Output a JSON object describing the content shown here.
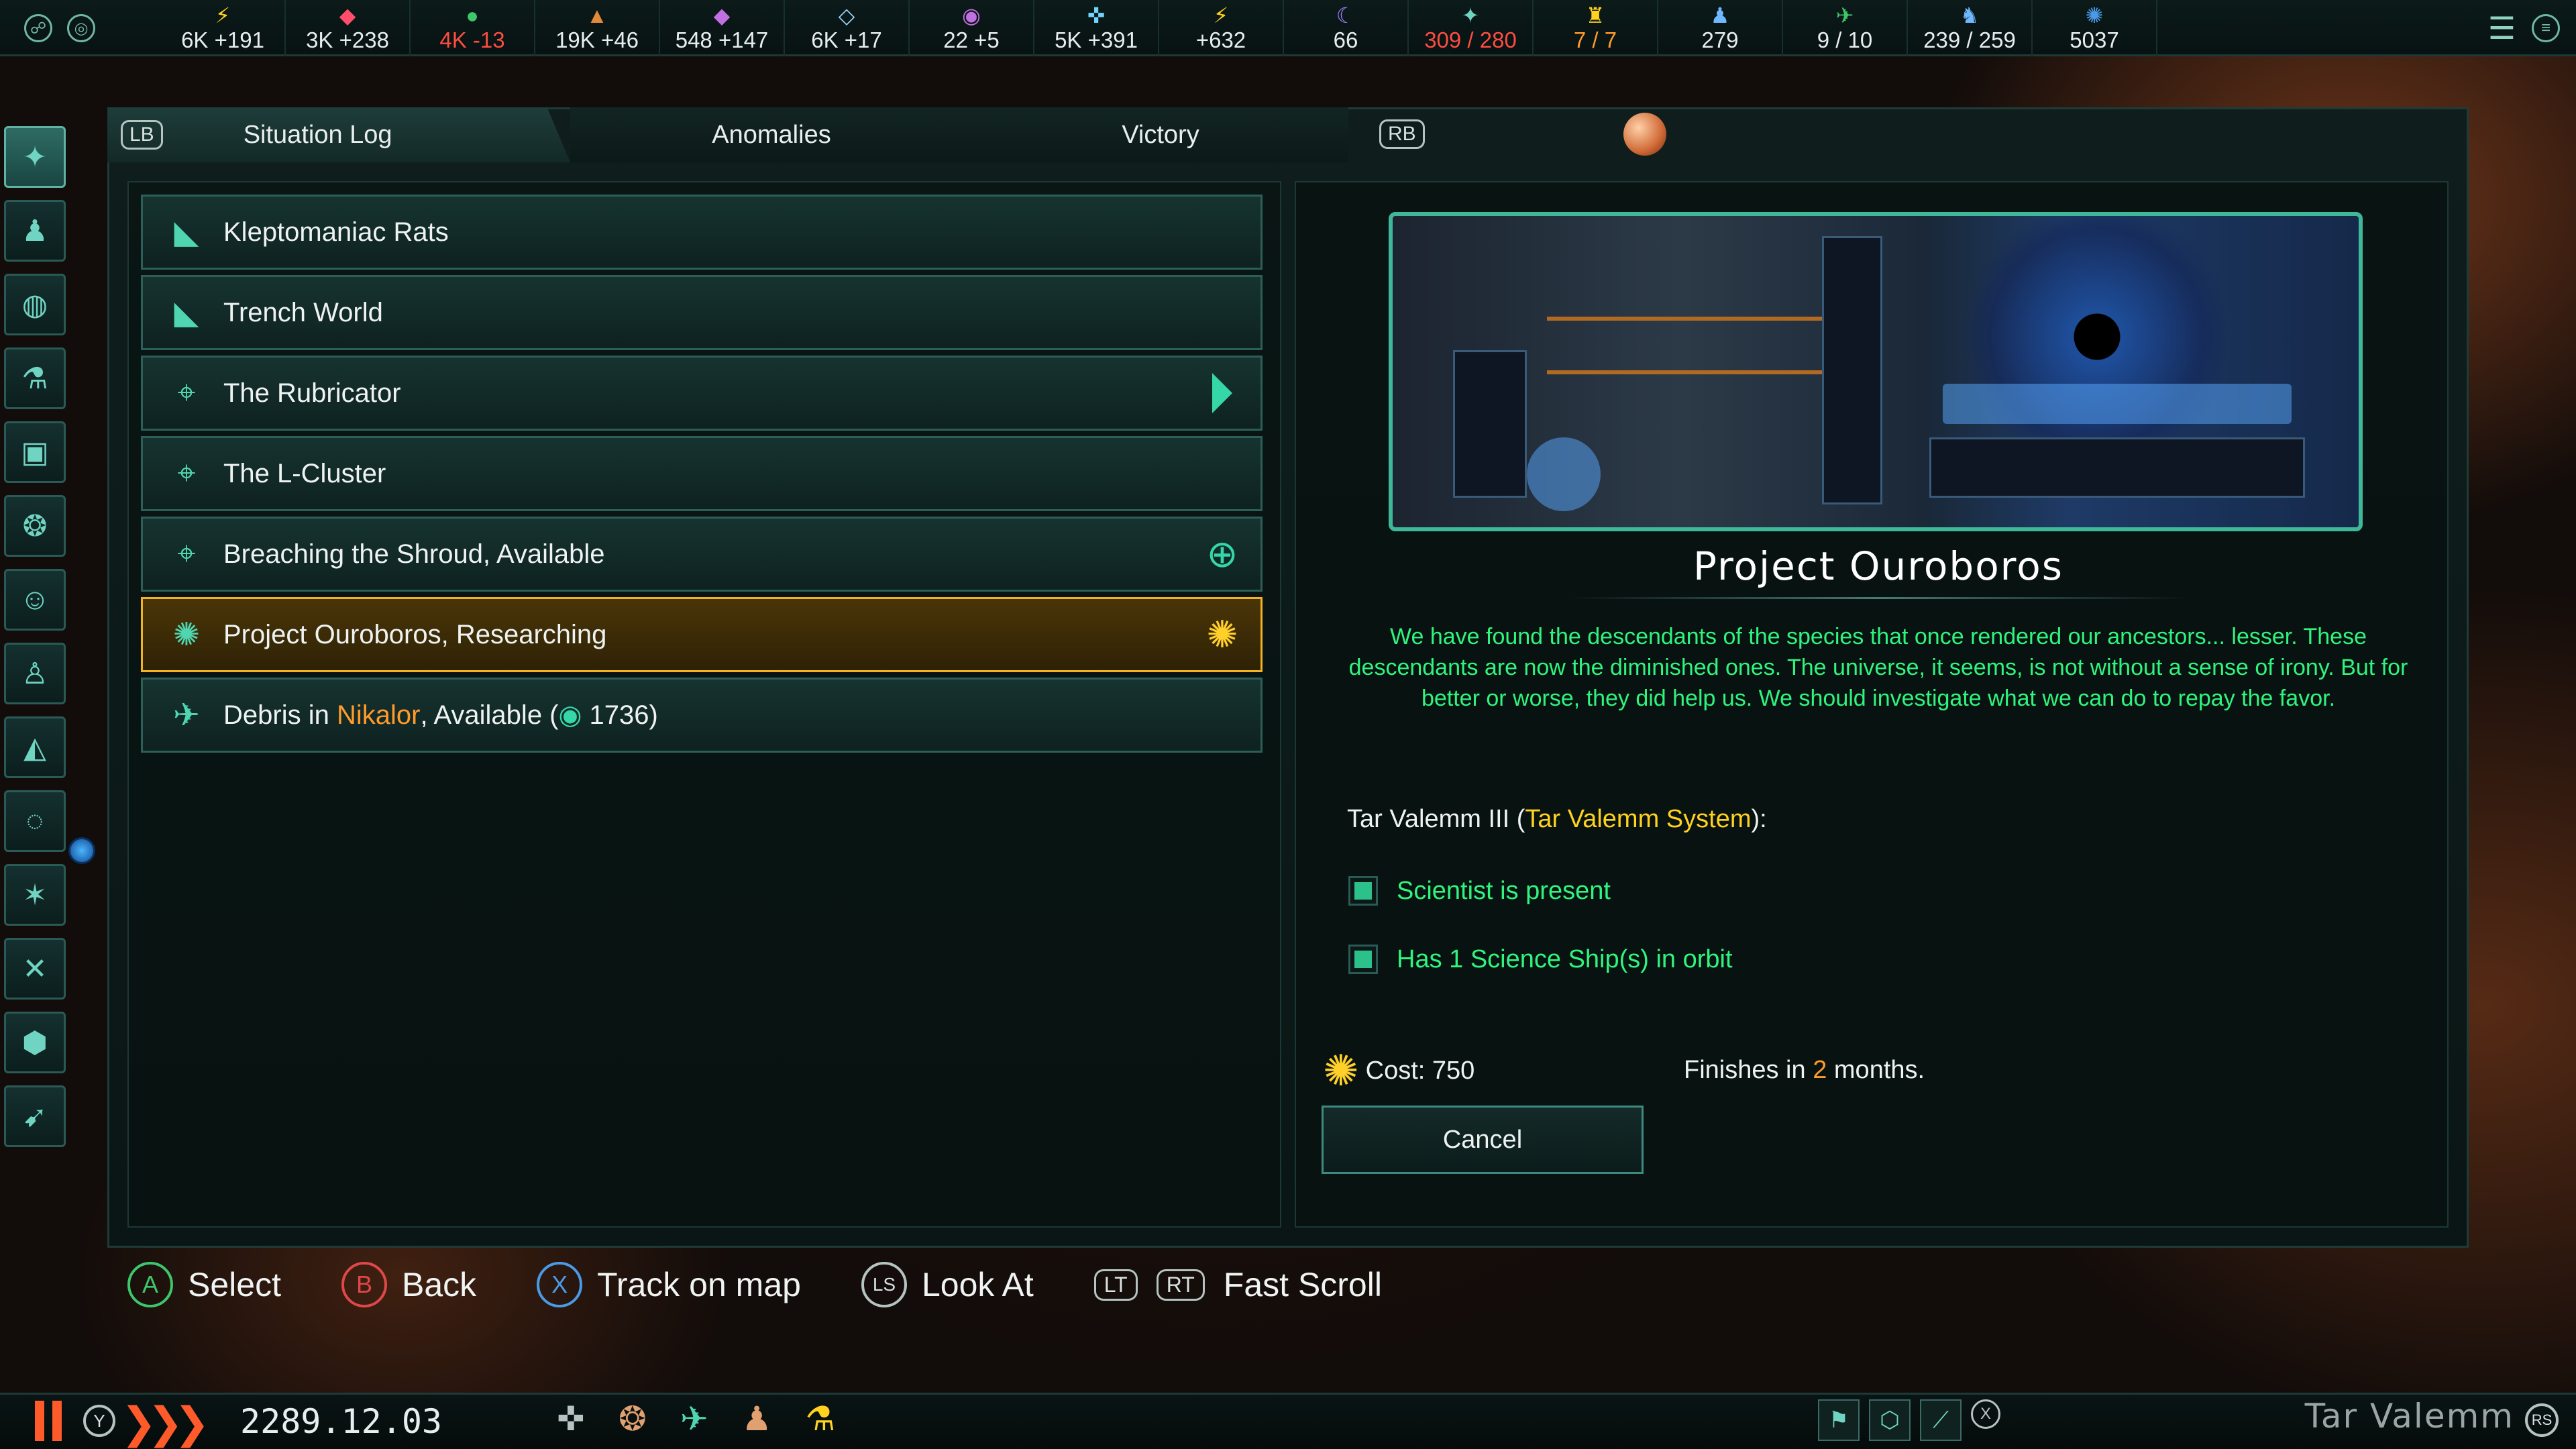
{
  "topbar": {
    "resources": [
      {
        "icon": "energy-icon",
        "glyph": "⚡",
        "color": "#ffd21e",
        "value": "6K +191",
        "tone": ""
      },
      {
        "icon": "minerals-icon",
        "glyph": "◆",
        "color": "#ff4d6a",
        "value": "3K +238",
        "tone": ""
      },
      {
        "icon": "food-icon",
        "glyph": "●",
        "color": "#3ec66a",
        "value": "4K -13",
        "tone": "red"
      },
      {
        "icon": "consumer-goods-icon",
        "glyph": "▲",
        "color": "#e08a3a",
        "value": "19K +46",
        "tone": ""
      },
      {
        "icon": "alloys-icon",
        "glyph": "◆",
        "color": "#c070e0",
        "value": "548 +147",
        "tone": ""
      },
      {
        "icon": "influence-icon",
        "glyph": "◇",
        "color": "#9ad4ff",
        "value": "6K +17",
        "tone": ""
      },
      {
        "icon": "unity-icon",
        "glyph": "◉",
        "color": "#c070e0",
        "value": "22 +5",
        "tone": ""
      },
      {
        "icon": "research-icon",
        "glyph": "✜",
        "color": "#6fd4ff",
        "value": "5K +391",
        "tone": ""
      },
      {
        "icon": "amenities-icon",
        "glyph": "⚡",
        "color": "#ffd21e",
        "value": "+632",
        "tone": ""
      },
      {
        "icon": "stability-icon",
        "glyph": "☾",
        "color": "#a080ff",
        "value": "66",
        "tone": ""
      },
      {
        "icon": "naval-capacity-icon",
        "glyph": "✦",
        "color": "#6fd4c2",
        "value": "309 / 280",
        "tone": "red"
      },
      {
        "icon": "starbase-capacity-icon",
        "glyph": "♜",
        "color": "#ffd21e",
        "value": "7 / 7",
        "tone": "orange"
      },
      {
        "icon": "population-icon",
        "glyph": "♟",
        "color": "#6fb7ff",
        "value": "279",
        "tone": ""
      },
      {
        "icon": "envoys-icon",
        "glyph": "✈",
        "color": "#3ec66a",
        "value": "9 / 10",
        "tone": ""
      },
      {
        "icon": "colonies-icon",
        "glyph": "♞",
        "color": "#6fb7ff",
        "value": "239 / 259",
        "tone": ""
      },
      {
        "icon": "empire-size-icon",
        "glyph": "✺",
        "color": "#4a9ae8",
        "value": "5037",
        "tone": ""
      }
    ]
  },
  "tabs": {
    "lb": "LB",
    "rb": "RB",
    "situation_log": "Situation Log",
    "anomalies": "Anomalies",
    "victory": "Victory"
  },
  "log_items": [
    {
      "icon": "event-chain-icon",
      "glyph": "◣",
      "text": "Kleptomaniac Rats",
      "trail": ""
    },
    {
      "icon": "event-chain-icon",
      "glyph": "◣",
      "text": "Trench World",
      "trail": ""
    },
    {
      "icon": "location-pin-icon",
      "glyph": "⌖",
      "text": "The Rubricator",
      "trail": "arrow"
    },
    {
      "icon": "location-pin-icon",
      "glyph": "⌖",
      "text": "The L-Cluster",
      "trail": ""
    },
    {
      "icon": "location-pin-icon",
      "glyph": "⌖",
      "text": "Breaching the Shroud, Available",
      "trail": "globe"
    },
    {
      "icon": "research-gear-icon",
      "glyph": "✺",
      "text": "Project Ouroboros, Researching",
      "trail": "gear"
    },
    {
      "icon": "debris-icon",
      "glyph": "✈",
      "text_pre": "Debris in ",
      "text_hl": "Nikalor",
      "text_post": ", Available (",
      "text_num": " 1736)",
      "trail": ""
    }
  ],
  "detail": {
    "title": "Project Ouroboros",
    "description": "We have found the descendants of the species that once rendered our ancestors... lesser. These descendants are now the diminished ones. The universe, it seems, is not without a sense of irony. But for better or worse, they did help us. We should investigate what we can do to repay the favor.",
    "location_planet": "Tar Valemm III",
    "location_system": "Tar Valemm System",
    "requirements": [
      "Scientist is present",
      "Has 1 Science Ship(s) in orbit"
    ],
    "cost_label": "Cost: 750",
    "finish_pre": "Finishes in ",
    "finish_num": "2",
    "finish_post": " months.",
    "cancel_label": "Cancel"
  },
  "hints": [
    {
      "pad": "A",
      "kind": "a",
      "label": "Select"
    },
    {
      "pad": "B",
      "kind": "b",
      "label": "Back"
    },
    {
      "pad": "X",
      "kind": "x",
      "label": "Track on map"
    },
    {
      "pad": "LS",
      "kind": "ls",
      "label": "Look At"
    }
  ],
  "fast_scroll": {
    "lt": "LT",
    "rt": "RT",
    "label": "Fast Scroll"
  },
  "bottombar": {
    "y_badge": "Y",
    "speed": "❯❯❯",
    "date": "2289.12.03",
    "location": "Tar Valemm",
    "rs_badge": "RS",
    "x_badge": "X"
  }
}
